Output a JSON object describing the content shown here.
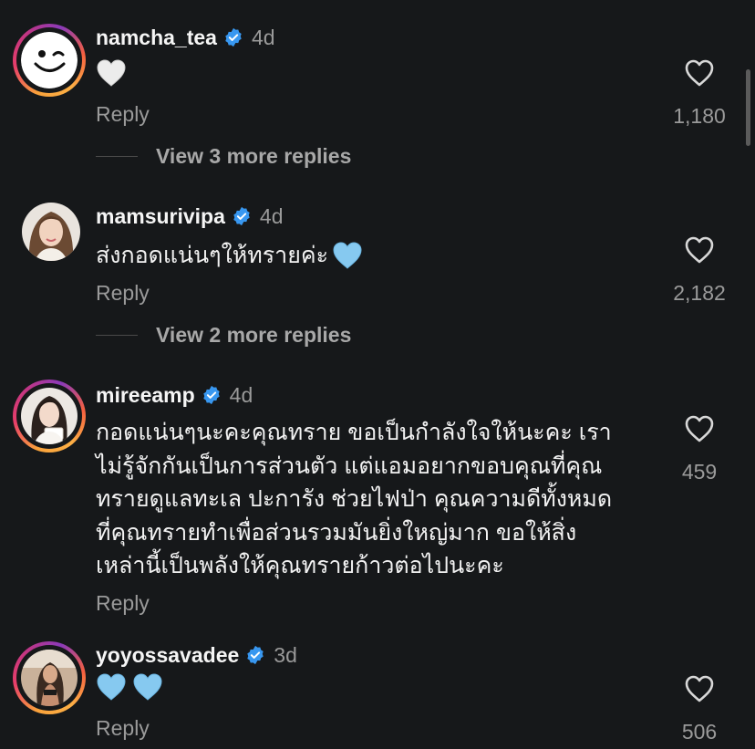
{
  "comments": [
    {
      "username": "namcha_tea",
      "age": "4d",
      "emoji": "white-heart",
      "reply_label": "Reply",
      "likes": "1,180",
      "view_replies": "View 3 more replies"
    },
    {
      "username": "mamsurivipa",
      "age": "4d",
      "text": "ส่งกอดแน่นๆให้ทรายค่ะ",
      "emoji": "light-blue-heart",
      "reply_label": "Reply",
      "likes": "2,182",
      "view_replies": "View 2 more replies"
    },
    {
      "username": "mireeamp",
      "age": "4d",
      "text_lines": [
        "กอดแน่นๆนะคะคุณทราย ขอเป็นกำลังใจให้นะคะ เรา",
        "ไม่รู้จักกันเป็นการส่วนตัว แต่แอมอยากขอบคุณที่คุณ",
        "ทรายดูแลทะเล ปะการัง ช่วยไฟป่า คุณความดีทั้งหมด",
        "ที่คุณทรายทำเพื่อส่วนรวมมันยิ่งใหญ่มาก ขอให้สิ่ง",
        "เหล่านี้เป็นพลังให้คุณทรายก้าวต่อไปนะคะ"
      ],
      "reply_label": "Reply",
      "likes": "459"
    },
    {
      "username": "yoyossavadee",
      "age": "3d",
      "emoji": "two-light-blue-hearts",
      "reply_label": "Reply",
      "likes": "506"
    }
  ],
  "colors": {
    "background": "#16181a",
    "verified": "#3897f0",
    "muted": "#9a9a9a",
    "light_blue_heart": "#86c9f0"
  }
}
